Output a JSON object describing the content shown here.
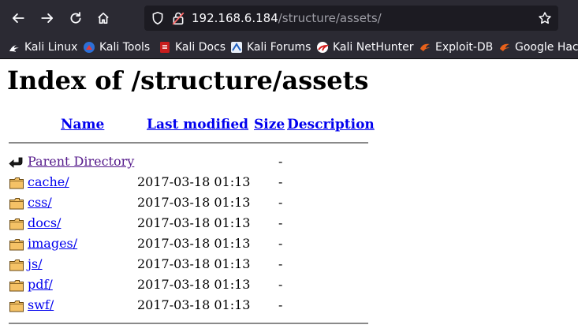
{
  "browser": {
    "url_host": "192.168.6.184",
    "url_path": "/structure/assets/",
    "bookmarks": [
      {
        "label": "Kali Linux",
        "icon": "kali-dragon-icon"
      },
      {
        "label": "Kali Tools",
        "icon": "kali-tools-icon"
      },
      {
        "label": "Kali Docs",
        "icon": "kali-docs-icon"
      },
      {
        "label": "Kali Forums",
        "icon": "kali-forums-icon"
      },
      {
        "label": "Kali NetHunter",
        "icon": "kali-nethunter-icon"
      },
      {
        "label": "Exploit-DB",
        "icon": "exploit-db-icon"
      },
      {
        "label": "Google Hack",
        "icon": "google-hacking-icon"
      }
    ]
  },
  "page": {
    "title": "Index of /structure/assets",
    "columns": {
      "name": "Name",
      "last_modified": "Last modified",
      "size": "Size",
      "description": "Description"
    },
    "parent": {
      "name": "Parent Directory",
      "size": "-"
    },
    "entries": [
      {
        "name": "cache/",
        "modified": "2017-03-18 01:13",
        "size": "-"
      },
      {
        "name": "css/",
        "modified": "2017-03-18 01:13",
        "size": "-"
      },
      {
        "name": "docs/",
        "modified": "2017-03-18 01:13",
        "size": "-"
      },
      {
        "name": "images/",
        "modified": "2017-03-18 01:13",
        "size": "-"
      },
      {
        "name": "js/",
        "modified": "2017-03-18 01:13",
        "size": "-"
      },
      {
        "name": "pdf/",
        "modified": "2017-03-18 01:13",
        "size": "-"
      },
      {
        "name": "swf/",
        "modified": "2017-03-18 01:13",
        "size": "-"
      }
    ]
  },
  "colors": {
    "chrome_bg": "#2b2a33",
    "urlbar_bg": "#1c1b22",
    "link": "#0000ee",
    "visited": "#551a8b"
  }
}
